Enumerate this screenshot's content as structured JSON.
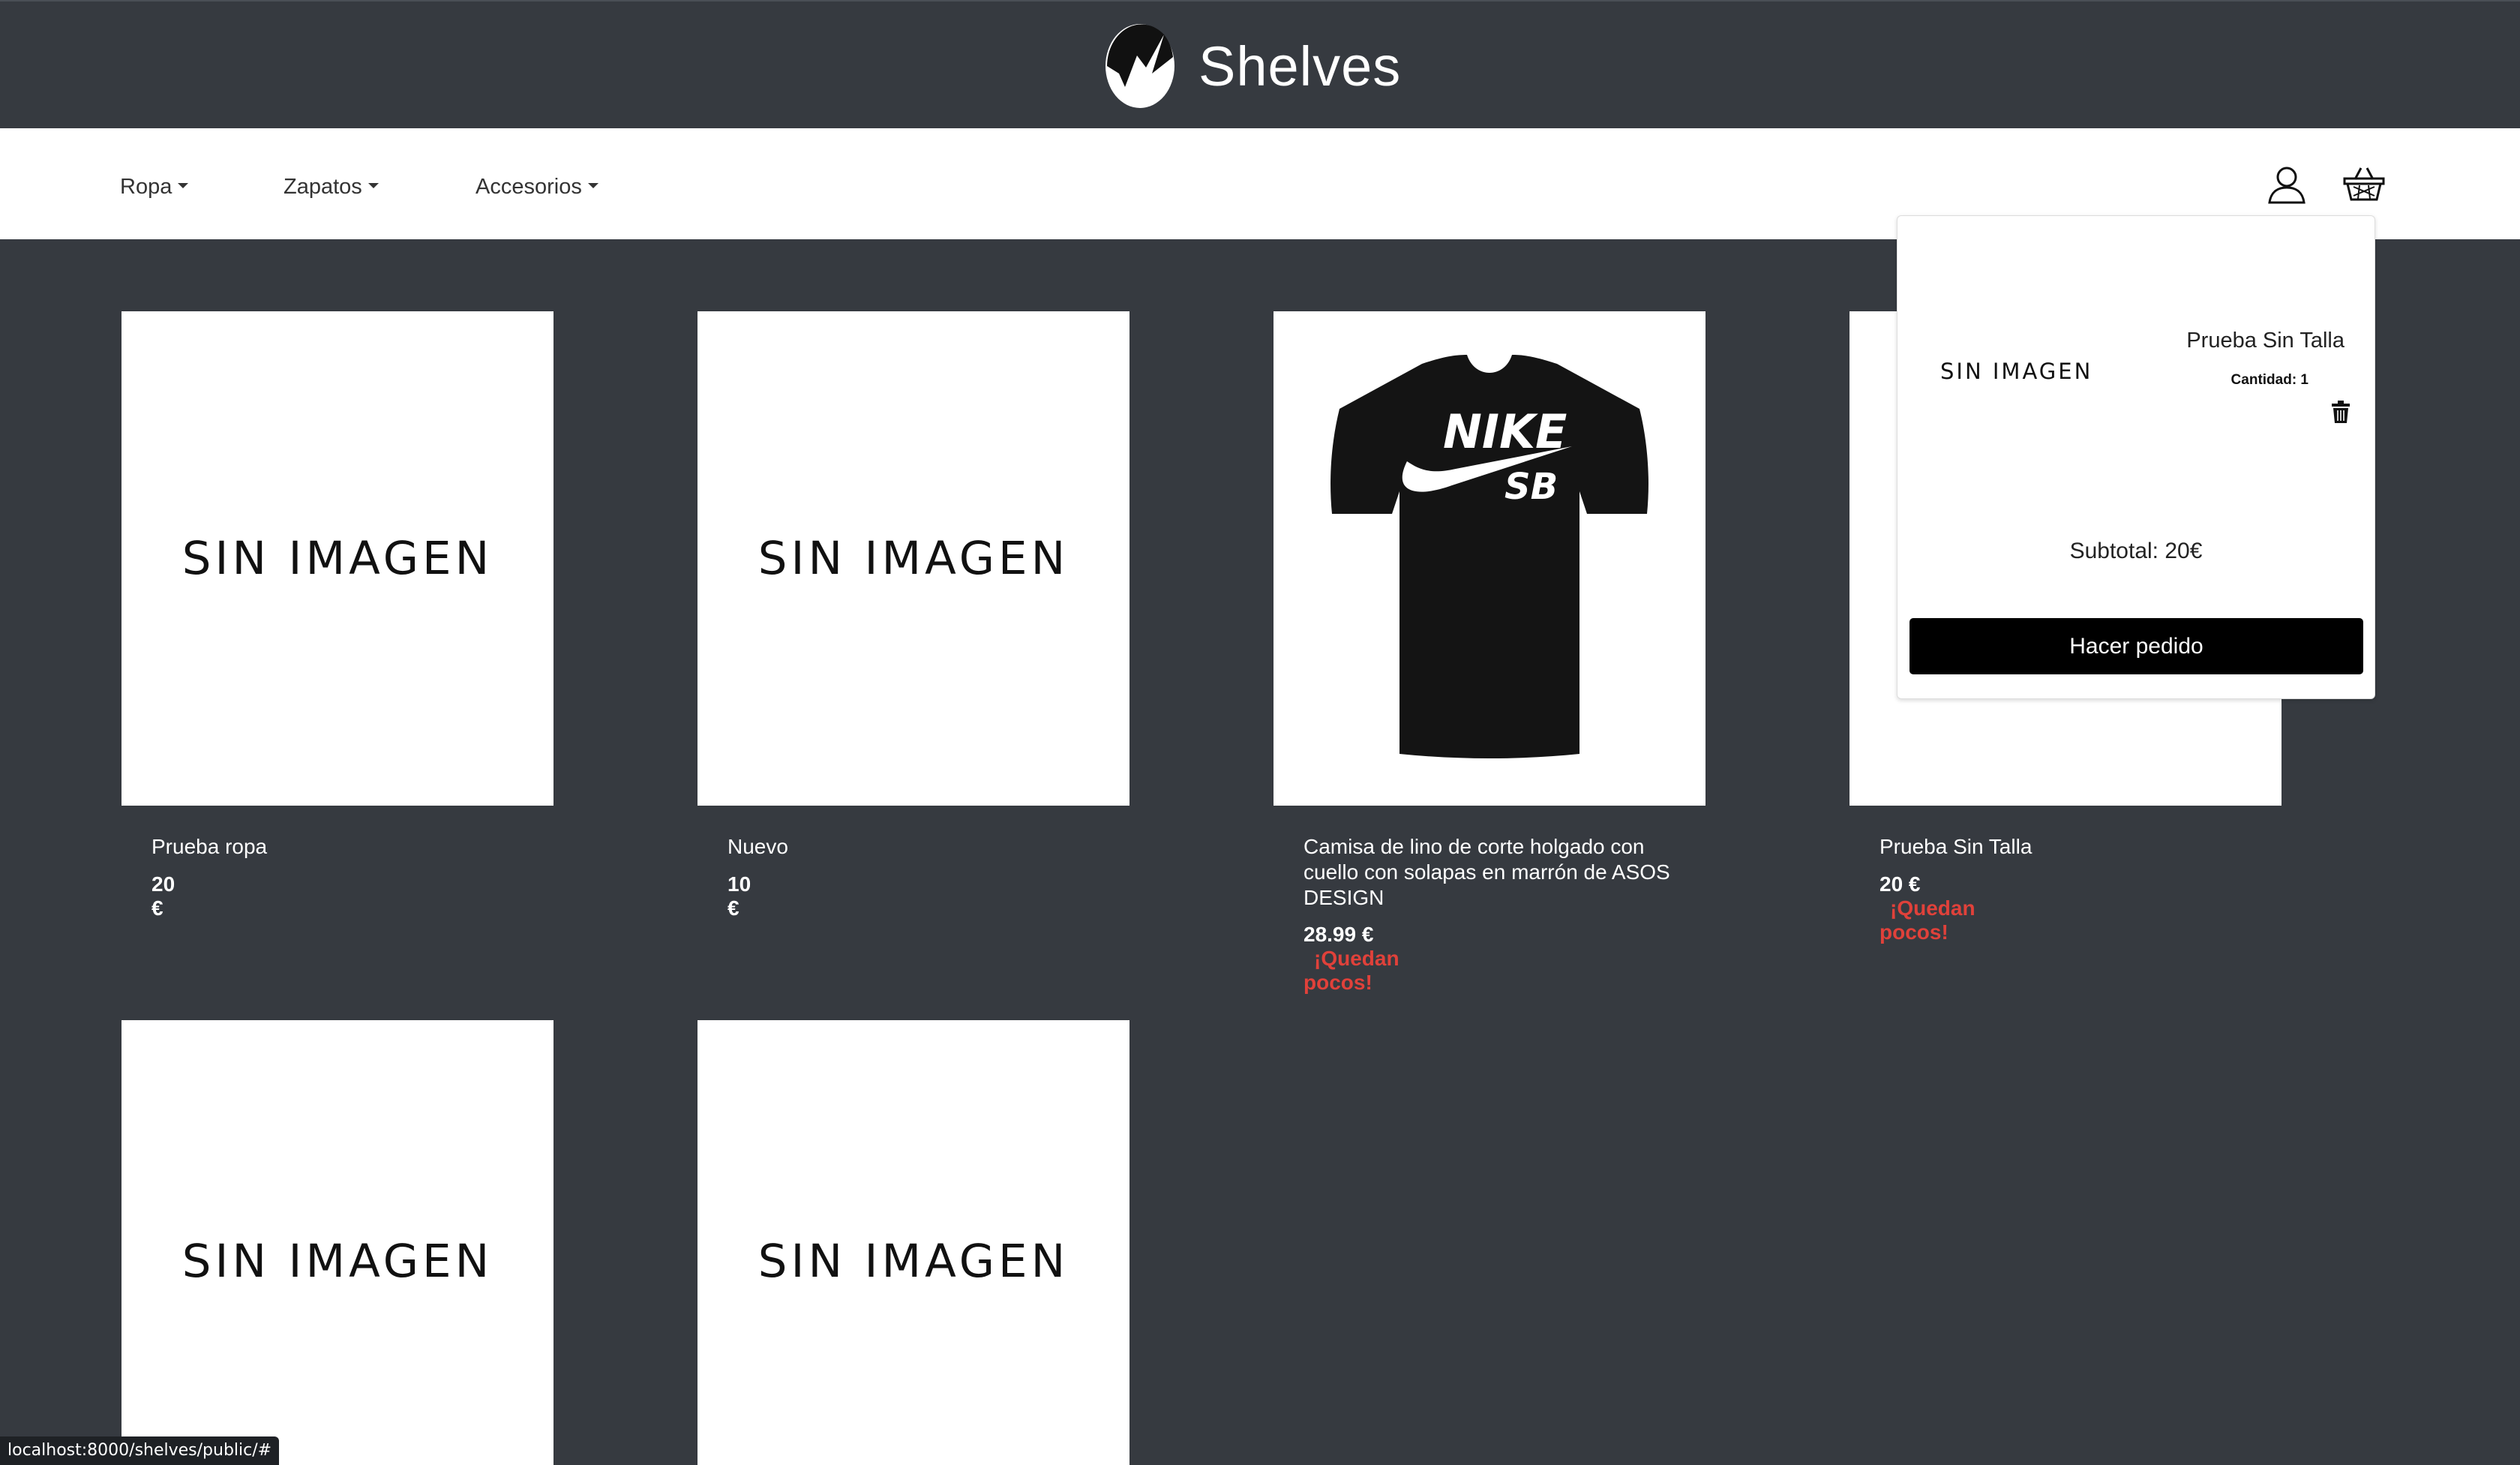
{
  "brand": {
    "name": "Shelves"
  },
  "nav": {
    "items": [
      {
        "label": "Ropa"
      },
      {
        "label": "Zapatos"
      },
      {
        "label": "Accesorios"
      }
    ],
    "user_icon": "user-icon",
    "cart_icon": "basket-icon"
  },
  "no_image_text": "SIN IMAGEN",
  "products": [
    {
      "name": "Prueba ropa",
      "price": "20 €",
      "stock_note": "",
      "image": "none"
    },
    {
      "name": "Nuevo",
      "price": "10 €",
      "stock_note": "",
      "image": "none"
    },
    {
      "name": "Camisa de lino de corte holgado con cuello con solapas en marrón de ASOS DESIGN",
      "price": "28.99 €",
      "stock_note": "¡Quedan pocos!",
      "image": "black-nike-sb-tshirt"
    },
    {
      "name": "Prueba Sin Talla",
      "price": "20 €",
      "stock_note": "¡Quedan pocos!",
      "image": "none"
    },
    {
      "name": "",
      "price": "",
      "stock_note": "",
      "image": "none"
    },
    {
      "name": "",
      "price": "",
      "stock_note": "",
      "image": "none"
    }
  ],
  "tshirt_print": {
    "line1": "NIKE",
    "line2": "SB"
  },
  "cart": {
    "item_image_text": "SIN IMAGEN",
    "item_name": "Prueba Sin Talla",
    "item_quantity": "Cantidad: 1",
    "subtotal": "Subtotal: 20€",
    "checkout_label": "Hacer pedido"
  },
  "status_url": "localhost:8000/shelves/public/#",
  "colors": {
    "background": "#363a40",
    "low_stock": "#e0413a",
    "button": "#000000"
  }
}
